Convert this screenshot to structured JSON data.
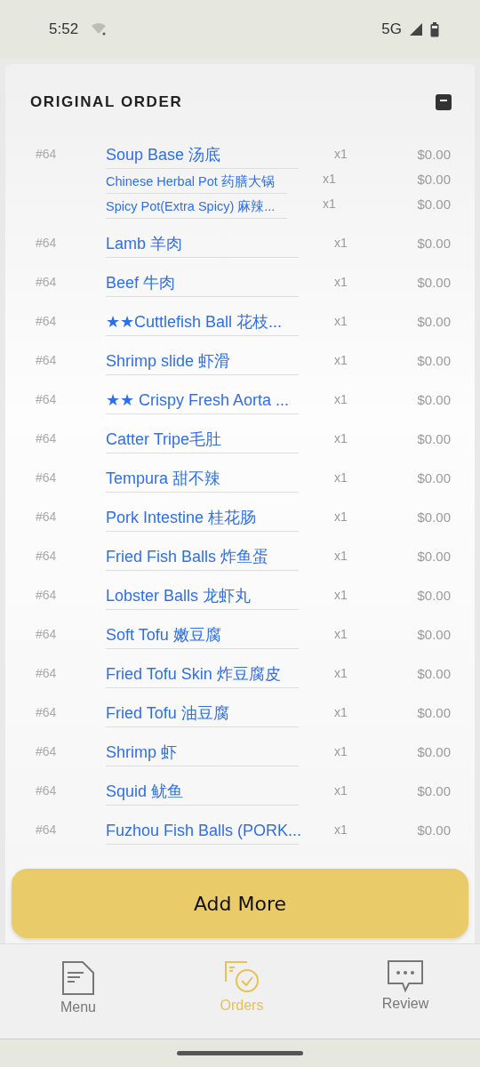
{
  "status_bar": {
    "time": "5:52",
    "network": "5G"
  },
  "section": {
    "title": "ORIGINAL ORDER",
    "expanded": true
  },
  "items": [
    {
      "number": "#64",
      "name": "Soup Base 汤底",
      "qty": "x1",
      "price": "$0.00",
      "children": [
        {
          "name": "Chinese Herbal Pot 药膳大锅",
          "qty": "x1",
          "price": "$0.00"
        },
        {
          "name": "Spicy Pot(Extra Spicy) 麻辣...",
          "qty": "x1",
          "price": "$0.00"
        }
      ]
    },
    {
      "number": "#64",
      "name": "Lamb 羊肉",
      "qty": "x1",
      "price": "$0.00"
    },
    {
      "number": "#64",
      "name": "Beef 牛肉",
      "qty": "x1",
      "price": "$0.00"
    },
    {
      "number": "#64",
      "name": "★★Cuttlefish Ball 花枝...",
      "qty": "x1",
      "price": "$0.00"
    },
    {
      "number": "#64",
      "name": "Shrimp slide 虾滑",
      "qty": "x1",
      "price": "$0.00"
    },
    {
      "number": "#64",
      "name": "★★ Crispy Fresh Aorta ...",
      "qty": "x1",
      "price": "$0.00"
    },
    {
      "number": "#64",
      "name": "Catter Tripe毛肚",
      "qty": "x1",
      "price": "$0.00"
    },
    {
      "number": "#64",
      "name": "Tempura 甜不辣",
      "qty": "x1",
      "price": "$0.00"
    },
    {
      "number": "#64",
      "name": "Pork Intestine 桂花肠",
      "qty": "x1",
      "price": "$0.00"
    },
    {
      "number": "#64",
      "name": "Fried Fish Balls 炸鱼蛋",
      "qty": "x1",
      "price": "$0.00"
    },
    {
      "number": "#64",
      "name": "Lobster Balls 龙虾丸",
      "qty": "x1",
      "price": "$0.00"
    },
    {
      "number": "#64",
      "name": "Soft Tofu 嫩豆腐",
      "qty": "x1",
      "price": "$0.00"
    },
    {
      "number": "#64",
      "name": "Fried Tofu Skin 炸豆腐皮",
      "qty": "x1",
      "price": "$0.00"
    },
    {
      "number": "#64",
      "name": "Fried Tofu 油豆腐",
      "qty": "x1",
      "price": "$0.00"
    },
    {
      "number": "#64",
      "name": "Shrimp 虾",
      "qty": "x1",
      "price": "$0.00"
    },
    {
      "number": "#64",
      "name": "Squid 鱿鱼",
      "qty": "x1",
      "price": "$0.00"
    },
    {
      "number": "#64",
      "name": "Fuzhou Fish Balls (PORK...",
      "qty": "x1",
      "price": "$0.00"
    }
  ],
  "add_button": {
    "label": "Add More"
  },
  "nav": [
    {
      "kind": "menu",
      "label": "Menu",
      "selected": false
    },
    {
      "kind": "orders",
      "label": "Orders",
      "selected": true
    },
    {
      "kind": "review",
      "label": "Review",
      "selected": false
    }
  ]
}
